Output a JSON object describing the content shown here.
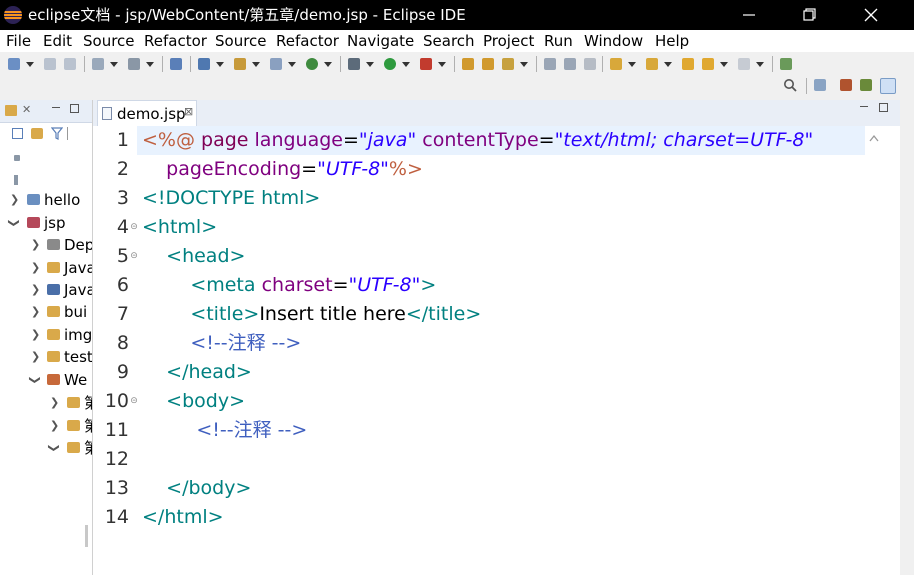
{
  "window": {
    "title": "eclipse文档 - jsp/WebContent/第五章/demo.jsp - Eclipse IDE",
    "minimize_glyph": "minimize-icon",
    "maximize_glyph": "maximize-icon",
    "close_glyph": "close-icon"
  },
  "menu": [
    "File",
    "Edit",
    "Source",
    "Refactor",
    "Source",
    "Refactor",
    "Navigate",
    "Search",
    "Project",
    "Run",
    "Window",
    "Help"
  ],
  "explorer": {
    "tab_icon": "package-explorer-icon",
    "close_mark": "✕",
    "items": [
      {
        "label": "hello",
        "expanded": false,
        "depth": 0,
        "icon": "project-icon"
      },
      {
        "label": "jsp",
        "expanded": true,
        "depth": 0,
        "icon": "project-icon"
      },
      {
        "label": "Dep",
        "expanded": false,
        "depth": 1,
        "icon": "deployment-icon"
      },
      {
        "label": "Java",
        "expanded": false,
        "depth": 1,
        "icon": "folder-icon"
      },
      {
        "label": "Java",
        "expanded": false,
        "depth": 1,
        "icon": "library-icon"
      },
      {
        "label": "bui",
        "expanded": false,
        "depth": 1,
        "icon": "folder-icon"
      },
      {
        "label": "img",
        "expanded": false,
        "depth": 1,
        "icon": "folder-icon"
      },
      {
        "label": "test",
        "expanded": false,
        "depth": 1,
        "icon": "folder-icon"
      },
      {
        "label": "We",
        "expanded": true,
        "depth": 1,
        "icon": "webcontent-icon"
      },
      {
        "label": "第",
        "expanded": false,
        "depth": 2,
        "icon": "folder-icon"
      },
      {
        "label": "第",
        "expanded": false,
        "depth": 2,
        "icon": "folder-icon"
      },
      {
        "label": "第",
        "expanded": true,
        "depth": 2,
        "icon": "folder-icon"
      }
    ]
  },
  "editor": {
    "tab_name": "demo.jsp",
    "tab_close": "⊠",
    "lines": [
      {
        "n": "1",
        "fold": false,
        "tokens": [
          [
            "<%@ ",
            "#bf5f3f",
            false
          ],
          [
            "page ",
            "#7f0055",
            false
          ],
          [
            "language",
            "#7f007f",
            false
          ],
          [
            "=",
            "#000000",
            false
          ],
          [
            "\"java\"",
            "#2a00ff",
            true
          ],
          [
            " contentType",
            "#7f007f",
            false
          ],
          [
            "=",
            "#000000",
            false
          ],
          [
            "\"text/html; charset=UTF-8\"",
            "#2a00ff",
            true
          ]
        ]
      },
      {
        "n": "2",
        "fold": false,
        "tokens": [
          [
            "    pageEncoding",
            "#7f007f",
            false
          ],
          [
            "=",
            "#000000",
            false
          ],
          [
            "\"UTF-8\"",
            "#2a00ff",
            true
          ],
          [
            "%>",
            "#bf5f3f",
            false
          ]
        ]
      },
      {
        "n": "3",
        "fold": false,
        "tokens": [
          [
            "<!DOCTYPE html>",
            "#008080",
            false
          ]
        ]
      },
      {
        "n": "4",
        "fold": true,
        "tokens": [
          [
            "<html>",
            "#008080",
            false
          ]
        ]
      },
      {
        "n": "5",
        "fold": true,
        "tokens": [
          [
            "    <head>",
            "#008080",
            false
          ]
        ]
      },
      {
        "n": "6",
        "fold": false,
        "tokens": [
          [
            "        <meta ",
            "#008080",
            false
          ],
          [
            "charset",
            "#7f007f",
            false
          ],
          [
            "=",
            "#000000",
            false
          ],
          [
            "\"UTF-8\"",
            "#2a00ff",
            true
          ],
          [
            ">",
            "#008080",
            false
          ]
        ]
      },
      {
        "n": "7",
        "fold": false,
        "tokens": [
          [
            "        <title>",
            "#008080",
            false
          ],
          [
            "Insert title here",
            "#000000",
            false
          ],
          [
            "</title>",
            "#008080",
            false
          ]
        ]
      },
      {
        "n": "8",
        "fold": false,
        "tokens": [
          [
            "        <!--注释 -->",
            "#3f5fbf",
            false
          ]
        ]
      },
      {
        "n": "9",
        "fold": false,
        "tokens": [
          [
            "    </head>",
            "#008080",
            false
          ]
        ]
      },
      {
        "n": "10",
        "fold": true,
        "tokens": [
          [
            "    <body>",
            "#008080",
            false
          ]
        ]
      },
      {
        "n": "11",
        "fold": false,
        "tokens": [
          [
            "         <!--注释 -->",
            "#3f5fbf",
            false
          ]
        ]
      },
      {
        "n": "12",
        "fold": false,
        "tokens": []
      },
      {
        "n": "13",
        "fold": false,
        "tokens": [
          [
            "    </body>",
            "#008080",
            false
          ]
        ]
      },
      {
        "n": "14",
        "fold": false,
        "tokens": [
          [
            "</html>",
            "#008080",
            false
          ]
        ]
      }
    ]
  },
  "colors": {
    "tag": "#008080",
    "attr": "#7f007f",
    "value": "#2a00ff",
    "directive": "#bf5f3f",
    "comment": "#3f5fbf",
    "current_line": "#e8f2fe"
  }
}
